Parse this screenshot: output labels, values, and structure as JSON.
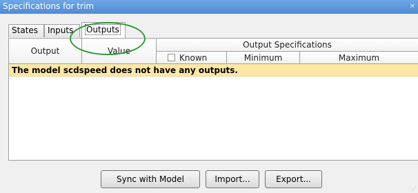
{
  "window": {
    "title": "Specifications for trim"
  },
  "tabs": [
    {
      "label": "States"
    },
    {
      "label": "Inputs"
    },
    {
      "label": "Outputs",
      "selected": true
    }
  ],
  "table": {
    "columns": {
      "output": "Output",
      "value": "Value",
      "group": "Output Specifications",
      "known": "Known",
      "minimum": "Minimum",
      "maximum": "Maximum"
    },
    "known_checked": false,
    "message": "The model scdspeed does not have any outputs."
  },
  "buttons": {
    "sync": "Sync with Model",
    "import": "Import...",
    "export": "Export..."
  },
  "colors": {
    "title_bar": "#5b96dd",
    "message_bg": "#ffe7a6",
    "annotation_ring": "#2a9a33"
  }
}
